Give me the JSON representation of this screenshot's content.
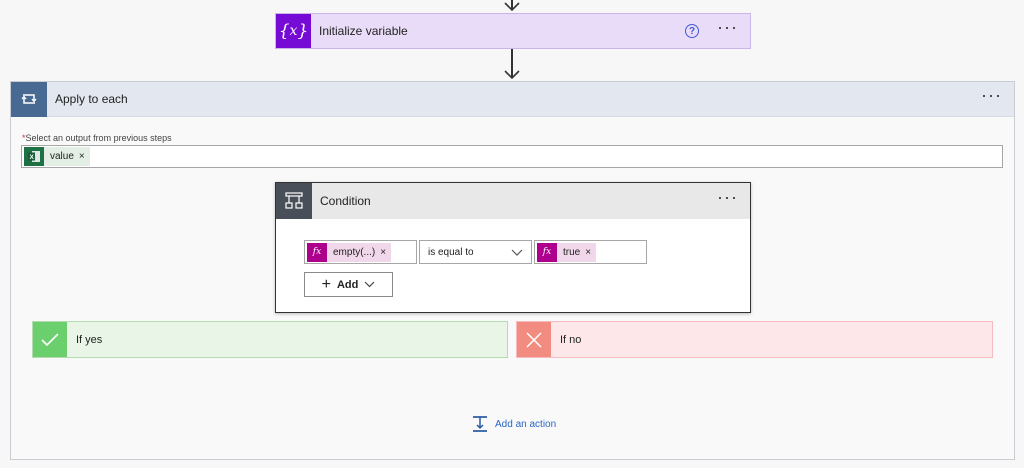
{
  "init_variable": {
    "title": "Initialize variable",
    "icon": "curly-brace-x-icon",
    "accent": "#770bd6",
    "background": "#e9dcf8",
    "help_glyph": "?",
    "more_glyph": "···"
  },
  "apply_to_each": {
    "title": "Apply to each",
    "icon": "loop-icon",
    "accent": "#486991",
    "more_glyph": "···",
    "select_required_marker": "*",
    "select_label": "Select an output from previous steps",
    "token": {
      "label": "value",
      "remove": "×",
      "icon": "excel-icon",
      "color": "#e3efe4"
    }
  },
  "condition": {
    "title": "Condition",
    "icon": "condition-branch-icon",
    "accent": "#484f58",
    "more_glyph": "···",
    "left_operand": {
      "fx": "fx",
      "label": "empty(...)",
      "remove": "×"
    },
    "operator": "is equal to",
    "right_operand": {
      "fx": "fx",
      "label": "true",
      "remove": "×"
    },
    "add_label": "Add",
    "add_plus": "+"
  },
  "branches": {
    "yes": {
      "label": "If yes",
      "icon": "checkmark-icon",
      "color": "#6ccf6e"
    },
    "no": {
      "label": "If no",
      "icon": "close-icon",
      "color": "#f28c81"
    }
  },
  "add_action": {
    "label": "Add an action",
    "icon": "add-action-icon"
  }
}
